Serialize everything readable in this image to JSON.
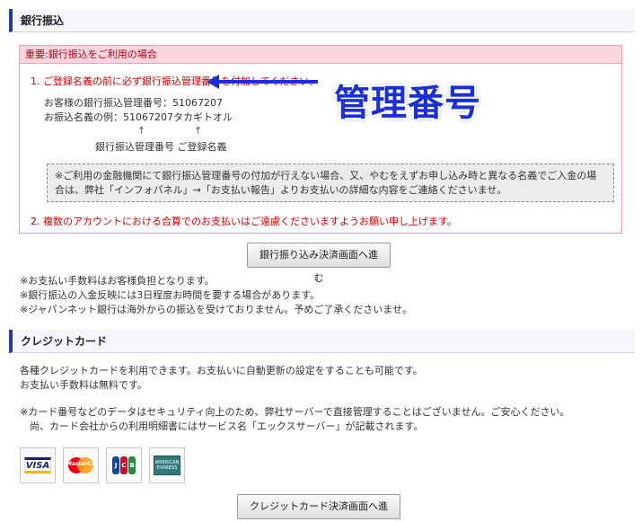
{
  "bank": {
    "heading": "銀行振込",
    "notice_title": "重要:銀行振込をご利用の場合",
    "item1": "1. ご登録名義の前に必ず銀行振込管理番号を付加してください。",
    "sample_line1": "お客様の銀行振込管理番号：51067207",
    "sample_line2": "お振込名義の例：51067207タカギトオル",
    "arrow": "↑",
    "label_number": "銀行振込管理番号",
    "label_name": "ご登録名義",
    "gray_note": "※ご利用の金融機関にて銀行振込管理番号の付加が行えない場合、又、やむをえずお申し込み時と異なる名義でご入金の場合は、弊社「インフォパネル」→「お支払い報告」よりお支払いの詳細な内容をご連絡くださいませ。",
    "item2": "2. 複数のアカウントにおける合算でのお支払いはご遠慮くださいますようお願い申し上げます。",
    "button": "銀行振り込み決済画面へ進む",
    "notes": [
      "※お支払い手数料はお客様負担となります。",
      "※銀行振込の入金反映には3日程度お時間を要する場合があります。",
      "※ジャパンネット銀行は海外からの振込を受けておりません。予めご了承くださいませ。"
    ]
  },
  "annotation": {
    "text": "管理番号"
  },
  "card": {
    "heading": "クレジットカード",
    "intro": [
      "各種クレジットカードを利用できます。お支払いに自動更新の設定をすることも可能です。",
      "お支払い手数料は無料です。"
    ],
    "security": [
      "※カード番号などのデータはセキュリティ向上のため、弊社サーバーで直接管理することはございません。ご安心ください。",
      "　尚、カード会社からの利用明細書にはサービス名「エックスサーバー」が記載されます。"
    ],
    "logos": {
      "visa": "VISA",
      "mastercard": "MasterCard",
      "jcb": [
        "J",
        "C",
        "B"
      ],
      "amex": "AMERICAN EXPRESS"
    },
    "button": "クレジットカード決済画面へ進む"
  }
}
